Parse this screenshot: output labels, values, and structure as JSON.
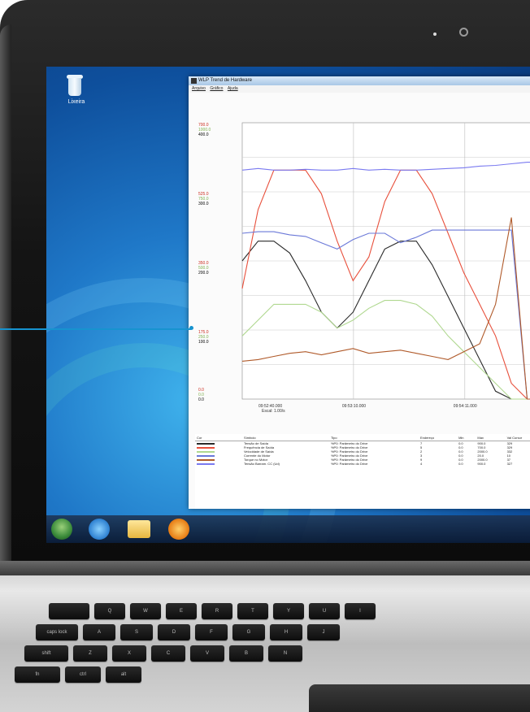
{
  "desktop": {
    "recycle_bin_label": "Lixeira"
  },
  "window": {
    "title": "WLP Trend de Hardware",
    "menu": [
      "Arquivo",
      "Gráfico",
      "Ajuda"
    ]
  },
  "chart_data": {
    "type": "line",
    "x_ticks": [
      "09:52:40.000",
      "09:53:10.000",
      "09:54:11.000"
    ],
    "x_footer": "Escal: 1.00/s",
    "y_axes": [
      {
        "color": "#cc2b1e",
        "ticks": [
          "700.0",
          "525.0",
          "350.0",
          "175.0",
          "0.0"
        ]
      },
      {
        "color": "#7fb050",
        "ticks": [
          "1000.0",
          "750.0",
          "500.0",
          "250.0",
          "0.0"
        ]
      },
      {
        "color": "#000000",
        "ticks": [
          "400.0",
          "300.0",
          "200.0",
          "100.0",
          "0.0"
        ]
      }
    ],
    "series": [
      {
        "color": "#2a2a2a",
        "values": [
          175,
          200,
          200,
          185,
          150,
          110,
          90,
          110,
          150,
          190,
          200,
          200,
          170,
          130,
          90,
          50,
          10,
          0,
          0,
          0
        ]
      },
      {
        "color": "#e8503c",
        "values": [
          140,
          240,
          290,
          290,
          290,
          260,
          200,
          150,
          180,
          250,
          290,
          290,
          260,
          210,
          160,
          120,
          80,
          20,
          0,
          0
        ]
      },
      {
        "color": "#6a78d8",
        "values": [
          210,
          212,
          212,
          208,
          206,
          198,
          190,
          202,
          210,
          210,
          198,
          205,
          214,
          214,
          214,
          214,
          214,
          214,
          0,
          0
        ]
      },
      {
        "color": "#b0d890",
        "values": [
          80,
          100,
          120,
          120,
          120,
          110,
          90,
          100,
          115,
          125,
          125,
          120,
          105,
          80,
          60,
          40,
          20,
          0,
          0,
          0
        ]
      },
      {
        "color": "#b05a2a",
        "values": [
          48,
          50,
          54,
          58,
          60,
          56,
          60,
          64,
          58,
          60,
          62,
          58,
          54,
          50,
          60,
          70,
          120,
          230,
          0,
          0
        ]
      },
      {
        "color": "#7a7af0",
        "values": [
          290,
          292,
          290,
          290,
          291,
          290,
          290,
          292,
          290,
          291,
          290,
          290,
          291,
          292,
          293,
          295,
          296,
          298,
          300,
          300
        ]
      }
    ]
  },
  "legend_table": {
    "headers": [
      "Cor",
      "Símbolo",
      "Tipo",
      "Endereço",
      "Min",
      "Max",
      "Val Cursor"
    ],
    "rows": [
      {
        "color": "#2a2a2a",
        "cells": [
          "Tensão de Saída",
          "%P0: Parâmetro do Drive",
          "7",
          "0.0",
          "900.0",
          "329"
        ]
      },
      {
        "color": "#e8503c",
        "cells": [
          "Frequência de Saída",
          "%P0: Parâmetro do Drive",
          "5",
          "0.0",
          "700.0",
          "329"
        ]
      },
      {
        "color": "#b0d890",
        "cells": [
          "Velocidade de Saída",
          "%P0: Parâmetro do Drive",
          "2",
          "0.0",
          "2000.0",
          "332"
        ]
      },
      {
        "color": "#6a78d8",
        "cells": [
          "Corrente do Motor",
          "%P0: Parâmetro do Drive",
          "3",
          "0.0",
          "20.0",
          "10"
        ]
      },
      {
        "color": "#b05a2a",
        "cells": [
          "Torque no Motor",
          "%P0: Parâmetro do Drive",
          "9",
          "0.0",
          "2000.0",
          "37"
        ]
      },
      {
        "color": "#7a7af0",
        "cells": [
          "Tensão Barram. CC (Ud)",
          "%P0: Parâmetro do Drive",
          "4",
          "0.0",
          "900.0",
          "327"
        ]
      }
    ]
  },
  "keyboard": {
    "row_a": [
      "",
      "Q",
      "W",
      "E",
      "R",
      "T",
      "Y",
      "U",
      "I"
    ],
    "row_b": [
      "caps lock",
      "A",
      "S",
      "D",
      "F",
      "G",
      "H",
      "J"
    ],
    "row_c": [
      "shift",
      "Z",
      "X",
      "C",
      "V",
      "B",
      "N"
    ],
    "row_d": [
      "fn",
      "ctrl",
      "alt"
    ]
  }
}
